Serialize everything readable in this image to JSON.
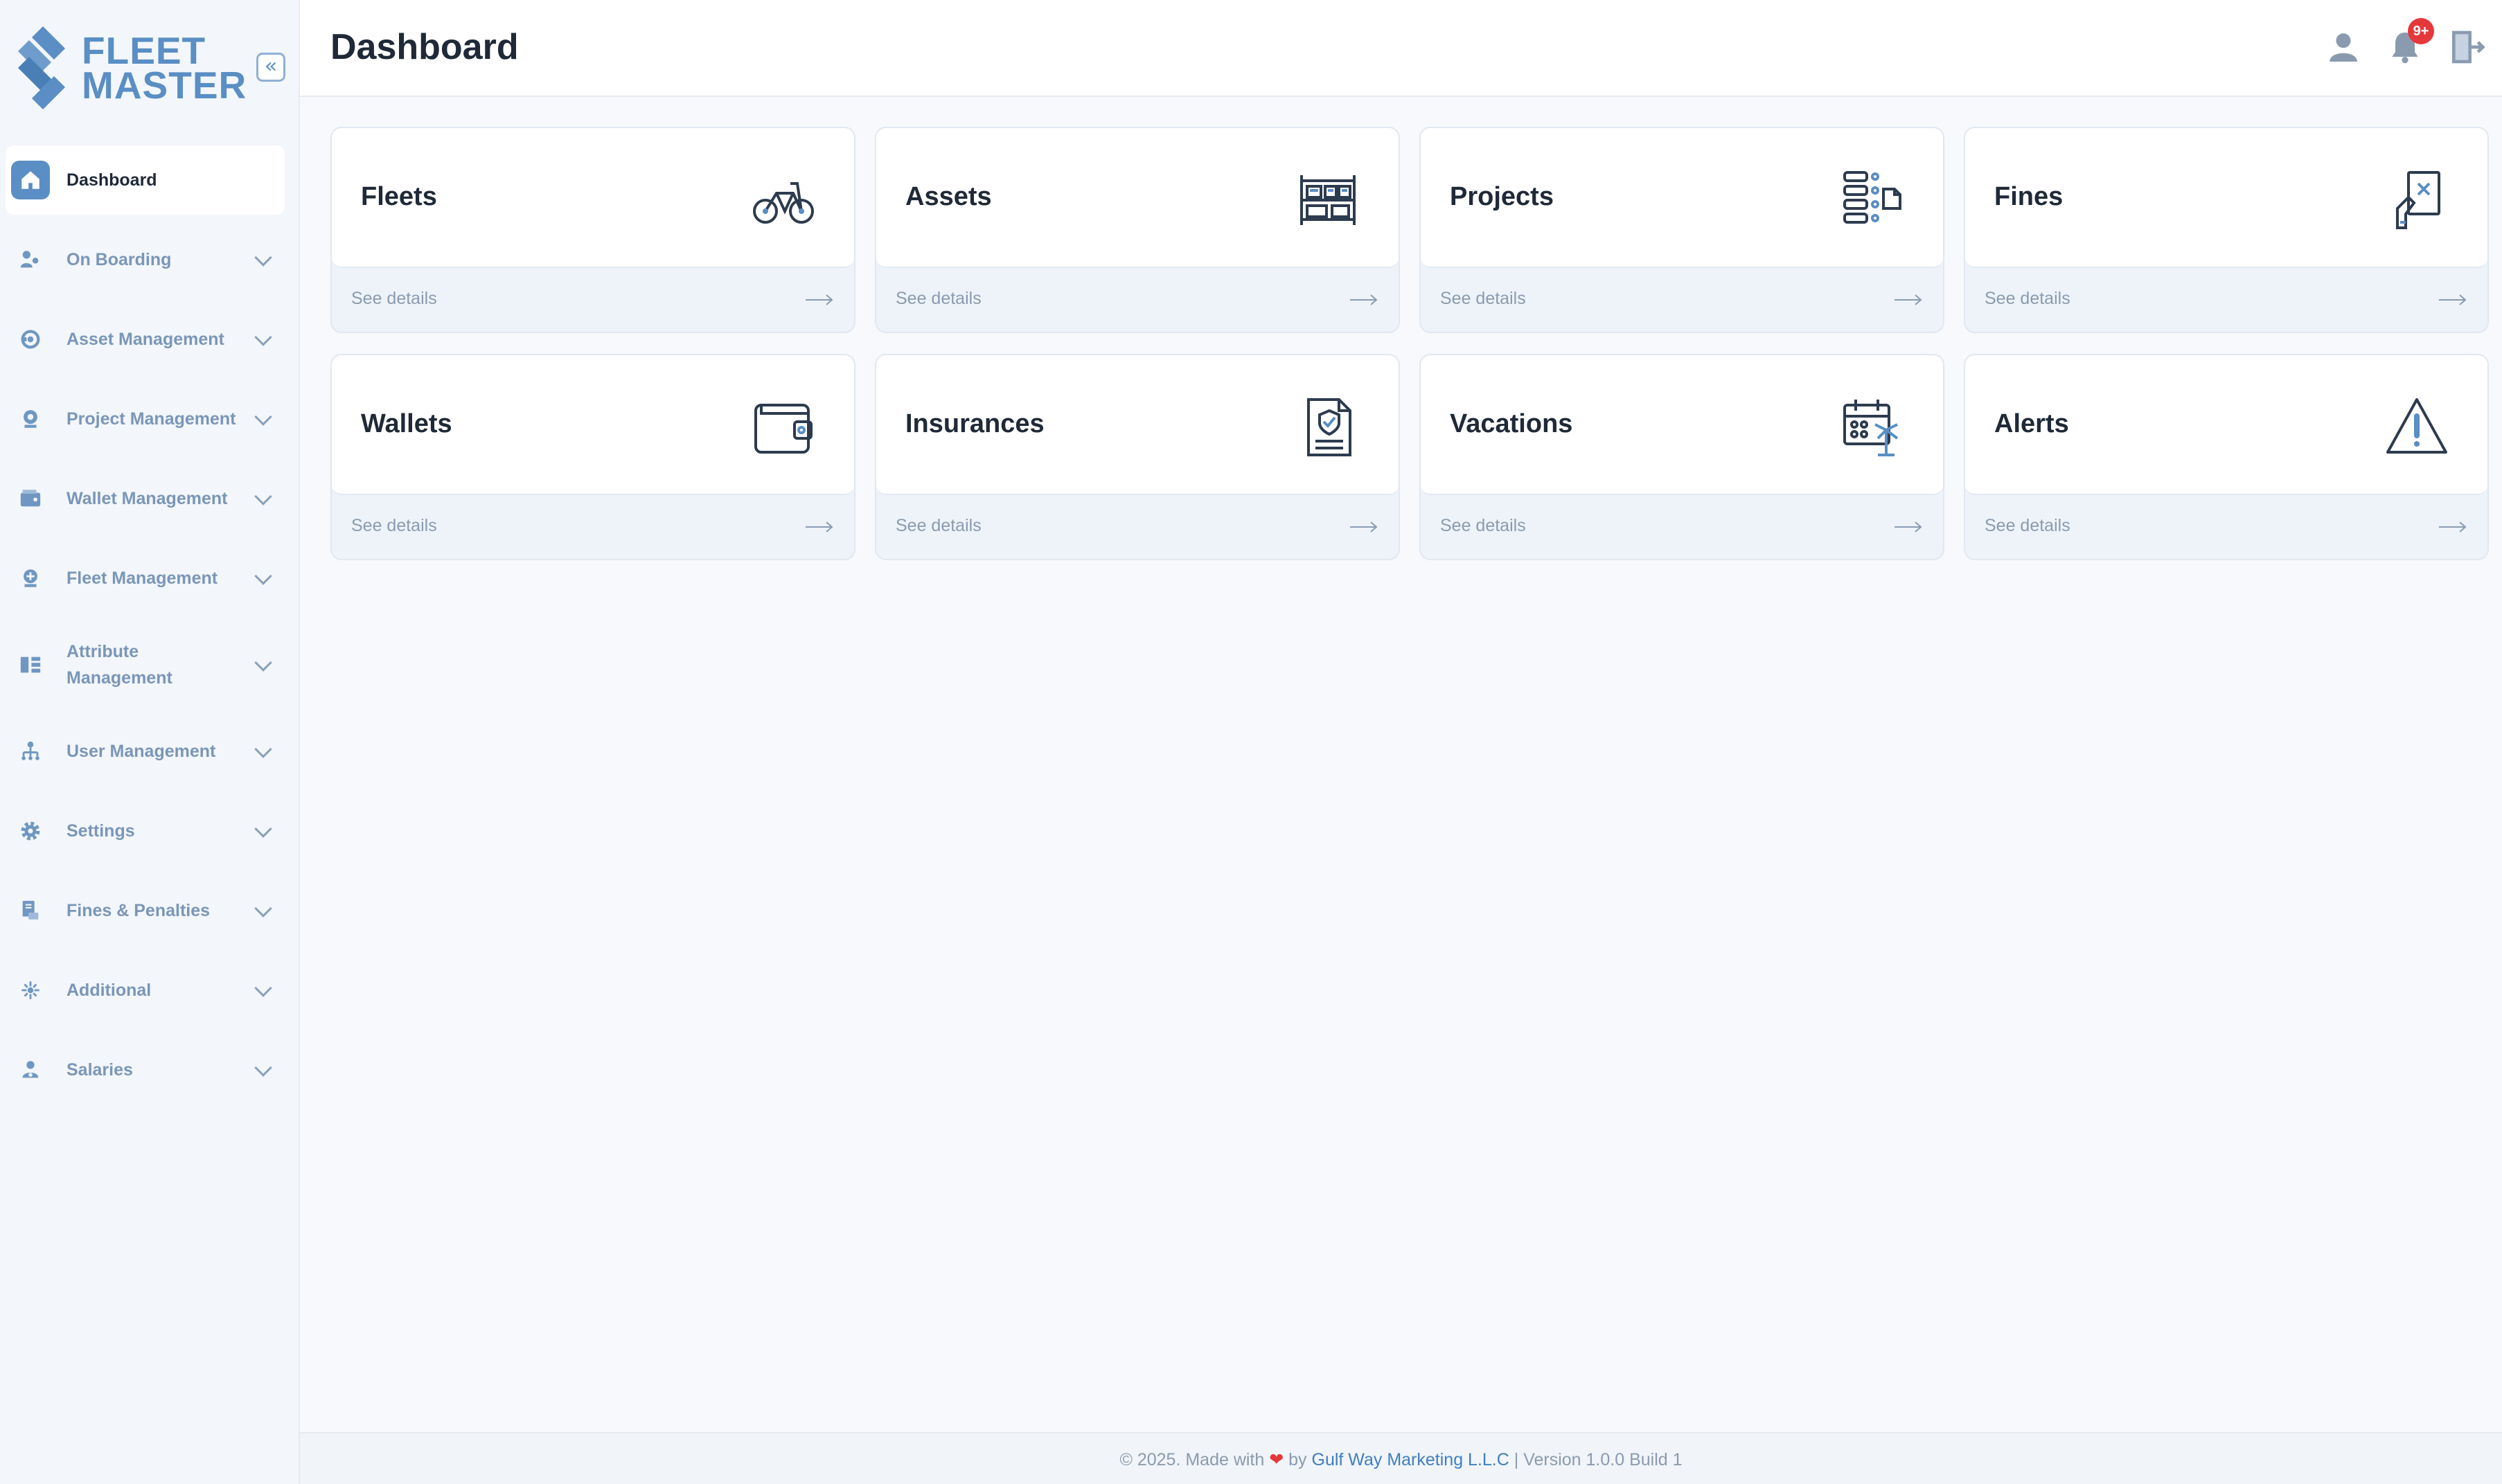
{
  "brand": {
    "line1": "FLEET",
    "line2": "MASTER",
    "color": "#5a8ec4"
  },
  "sidebar": {
    "collapse_glyph": "«",
    "items": [
      {
        "label": "Dashboard",
        "icon": "home-icon",
        "active": true
      },
      {
        "label": "On Boarding",
        "icon": "onboarding-icon"
      },
      {
        "label": "Asset Management",
        "icon": "asset-management-icon"
      },
      {
        "label": "Project Management",
        "icon": "project-management-icon"
      },
      {
        "label": "Wallet Management",
        "icon": "wallet-management-icon"
      },
      {
        "label": "Fleet Management",
        "icon": "fleet-management-icon"
      },
      {
        "label": "Attribute Management",
        "icon": "attribute-management-icon"
      },
      {
        "label": "User Management",
        "icon": "user-management-icon"
      },
      {
        "label": "Settings",
        "icon": "gear-icon"
      },
      {
        "label": "Fines & Penalties",
        "icon": "fines-penalties-icon"
      },
      {
        "label": "Additional",
        "icon": "additional-icon"
      },
      {
        "label": "Salaries",
        "icon": "salaries-icon"
      }
    ]
  },
  "header": {
    "title": "Dashboard",
    "notification_badge": "9+"
  },
  "cards": [
    {
      "title": "Fleets",
      "link": "See details",
      "icon": "bicycle-icon"
    },
    {
      "title": "Assets",
      "link": "See details",
      "icon": "shelves-icon"
    },
    {
      "title": "Projects",
      "link": "See details",
      "icon": "project-list-icon"
    },
    {
      "title": "Fines",
      "link": "See details",
      "icon": "fine-document-icon"
    },
    {
      "title": "Wallets",
      "link": "See details",
      "icon": "wallet-icon"
    },
    {
      "title": "Insurances",
      "link": "See details",
      "icon": "insurance-document-icon"
    },
    {
      "title": "Vacations",
      "link": "See details",
      "icon": "vacation-calendar-icon"
    },
    {
      "title": "Alerts",
      "link": "See details",
      "icon": "warning-triangle-icon"
    }
  ],
  "footer": {
    "prefix": "© 2025. Made with",
    "heart": "❤",
    "by": "by",
    "company": "Gulf Way Marketing L.L.C",
    "version": "| Version 1.0.0 Build 1"
  },
  "colors": {
    "accent": "#5a8ec4",
    "link": "#3f7fc0",
    "badge": "#e5383b",
    "text_muted": "#7a96b8"
  }
}
